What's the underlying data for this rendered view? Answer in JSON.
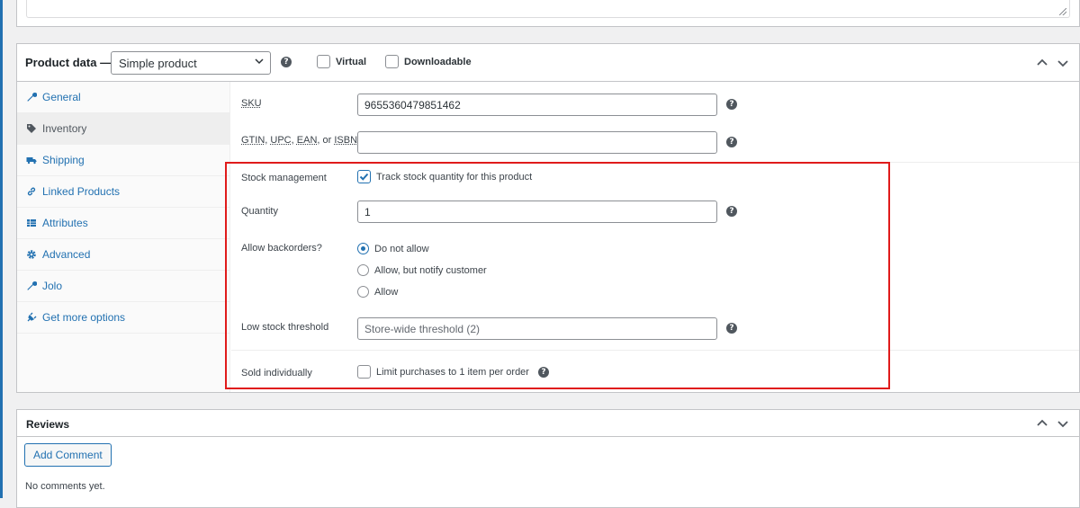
{
  "product_data": {
    "title": "Product data —",
    "type_value": "Simple product",
    "virtual_label": "Virtual",
    "downloadable_label": "Downloadable",
    "virtual_checked": false,
    "downloadable_checked": false
  },
  "tabs": [
    {
      "label": "General",
      "icon": "wrench-icon"
    },
    {
      "label": "Inventory",
      "icon": "tag-icon",
      "active": true
    },
    {
      "label": "Shipping",
      "icon": "truck-icon"
    },
    {
      "label": "Linked Products",
      "icon": "link-icon"
    },
    {
      "label": "Attributes",
      "icon": "table-icon"
    },
    {
      "label": "Advanced",
      "icon": "gear-icon"
    },
    {
      "label": "Jolo",
      "icon": "wrench-icon"
    },
    {
      "label": "Get more options",
      "icon": "plugin-icon"
    }
  ],
  "inventory": {
    "sku_label": "SKU",
    "sku_value": "9655360479851462",
    "gtin_label_parts": [
      "GTIN",
      "UPC",
      "EAN",
      "ISBN"
    ],
    "gtin_sep1": ", ",
    "gtin_sep2": ", ",
    "gtin_sep3": ", or ",
    "gtin_value": "",
    "stock_management_label": "Stock management",
    "track_stock_label": "Track stock quantity for this product",
    "track_stock_checked": true,
    "quantity_label": "Quantity",
    "quantity_value": "1",
    "backorders_label": "Allow backorders?",
    "backorder_options": [
      "Do not allow",
      "Allow, but notify customer",
      "Allow"
    ],
    "backorder_selected": 0,
    "low_stock_label": "Low stock threshold",
    "low_stock_placeholder": "Store-wide threshold (2)",
    "sold_individually_label": "Sold individually",
    "limit_purchases_label": "Limit purchases to 1 item per order",
    "limit_purchases_checked": false
  },
  "reviews": {
    "title": "Reviews",
    "add_comment_label": "Add Comment",
    "no_comments_text": "No comments yet."
  },
  "colors": {
    "link": "#2271b1",
    "highlight": "#e01b1b"
  }
}
